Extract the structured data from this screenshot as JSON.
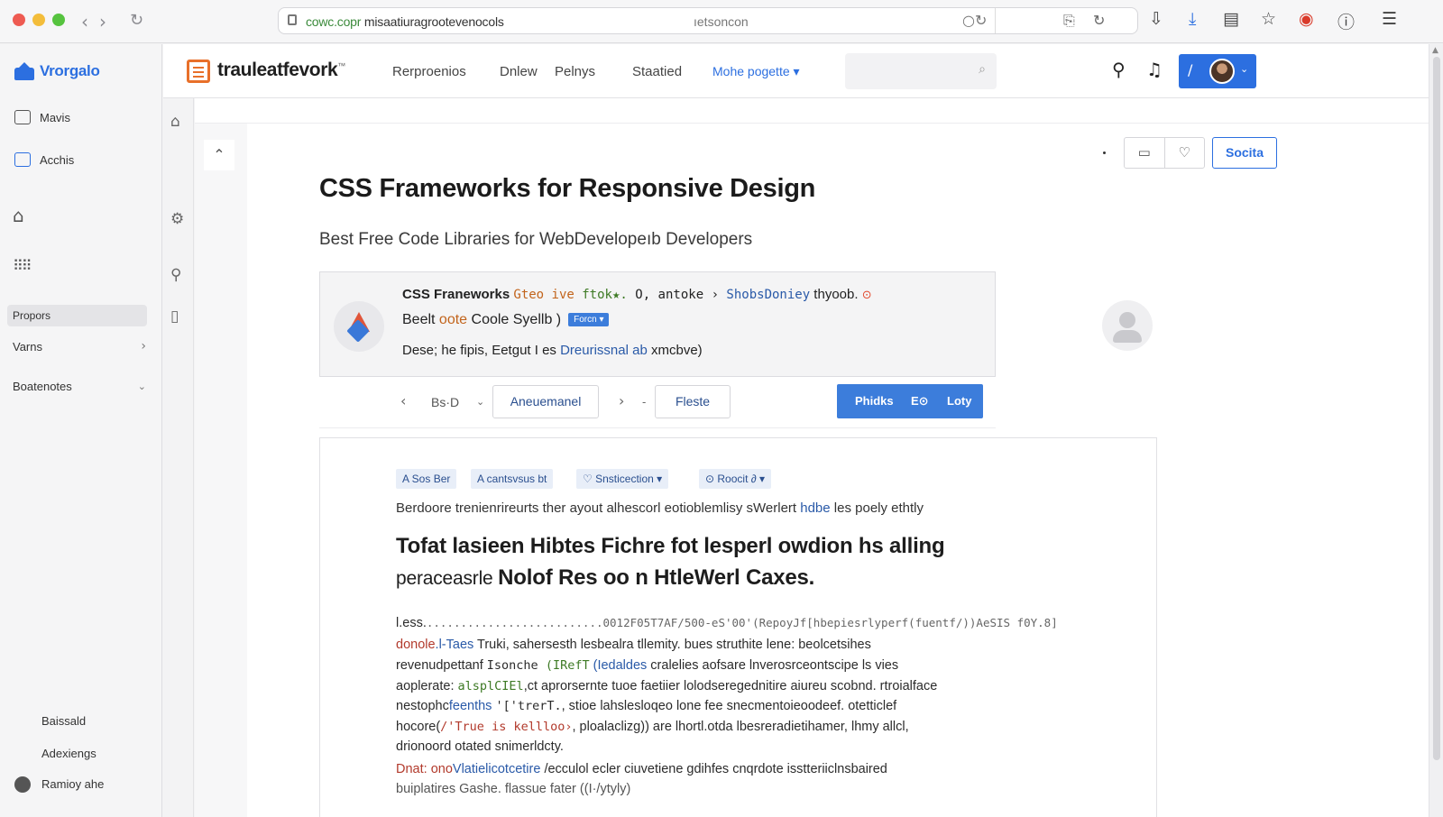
{
  "browser": {
    "url_prefix": "cowc.copr",
    "url_main": " misaatiuragrootevenocols",
    "url_center": "ıetsoncon",
    "nav_back": "‹",
    "nav_forward": "›",
    "reload": "↻"
  },
  "sidebar": {
    "brand": "Vrorgalo",
    "items_top": [
      "Mavis",
      "Acchis"
    ],
    "active_item": "Propors",
    "rows": [
      "Varns",
      "Boatenotes"
    ],
    "footer": [
      "Baissald",
      "Adexiengs",
      "Ramioy ahe"
    ]
  },
  "header": {
    "app_name": "trauleatfevork",
    "tm": "™",
    "nav": [
      "Rerproenios",
      "Dnlew",
      "Pelnys",
      "Staatied",
      "Mohe pogette ▾"
    ]
  },
  "toolbar": {
    "social_label": "Socita"
  },
  "page": {
    "title": "CSS Frameworks for Responsive Design",
    "subtitle": "Best Free Code Libraries for WebDevelopeıb Developers"
  },
  "card": {
    "line1_bold": "CSS Franeworks ",
    "line1_orange": "Gteo ive ",
    "line1_green": "ftok★. ",
    "line1_mono": "O, antoke ",
    "line1_rest": "› ",
    "line1_blue": "ShobsDoniey",
    "line1_tail": " thyoob.",
    "line1_warn": "⊙",
    "line2_a": "Beelt ",
    "line2_orange": "oote",
    "line2_b": " Coole Syellb )",
    "line2_tag": "Forcn ▾",
    "line3_a": "Dese; he fipis,  Eetgut I es ",
    "line3_blue": "Dreurissnal ab",
    "line3_b": " xmcbve)"
  },
  "toolbar2": {
    "pager": "Bs·D",
    "box1": "Aneuemanel",
    "box2": "Fleste",
    "primary_a": "Phidks",
    "primary_icon": "E⊙",
    "primary_b": "Loty"
  },
  "article": {
    "chips": [
      "A Sos Ber",
      "A cantsvsus bt",
      "♡ Snsticection ▾",
      "⊙ Roocit ∂ ▾"
    ],
    "lead_a": "Berdoore trenienrireurts ther ayout alhescorl eotioblemlisy sWerlert ",
    "lead_blue": "hdbe",
    "lead_b": " les poely ethtly",
    "headline": "Tofat lasieen Hibtes Fichre fot lesperl owdion hs alling",
    "headline2_lite": "peraceasrle ",
    "headline2_bold": "Nolof Res oo n HtleWerl Caxes.",
    "code": [
      {
        "a": "l.ess.",
        "dim": "..........................0012F05T7AF/500-eS'00'(RepoyJf[hbepiesrlyperf(fuentf/))AeSIS f0Y.8]",
        "b": ""
      },
      {
        "rd": "donole",
        "bl": ".l-Taes",
        "a": " Truki,  sahersesth  lesbealra  tllemity.  bues  struthite lene:  beolcetsihes"
      },
      {
        "a": "revenudpettanf  ",
        "mono": "Isonche",
        "gr": " (IRefT",
        "bl": " (Iedaldes",
        "b": " cralelies aofsare lnverosrceontscipe ls vies"
      },
      {
        "a": "aoplerate: ",
        "gr": "alsplCIEl",
        "b": ",ct aprorsernte tuoe faetiier lolodseregednitire aiureu scobnd. rtroialface"
      },
      {
        "a": "nestophc",
        "bl": "feenths ",
        "mono": "'['trerT.",
        "b": ",  stioe lahslesloqeo lone fee snecmentoieoodeef. otetticlef"
      },
      {
        "a": "hocore(",
        "rd": "/'True is kellloo›",
        "b": ", ploalaclizg))  are lhortl.otda  lbesreradietihamer,  lhmy allcl,"
      },
      {
        "a": "drionoord  otated snimerldcty.",
        "b": ""
      },
      {
        "rd": "Dnat:",
        "a": " ono",
        "bl": "Vlatielicotcetire",
        "b": " /ecculol  ecler  ciuvetiene  gdihfes  cnqrdote  isstteriiclnsbaired"
      },
      {
        "a": "buiplatires Gashe. flassue fater ((I·/ytyly)",
        "b": ""
      }
    ]
  },
  "colors": {
    "accent": "#2c6fe0",
    "brand_orange": "#e8702a",
    "primary_button": "#3c7ddb"
  }
}
